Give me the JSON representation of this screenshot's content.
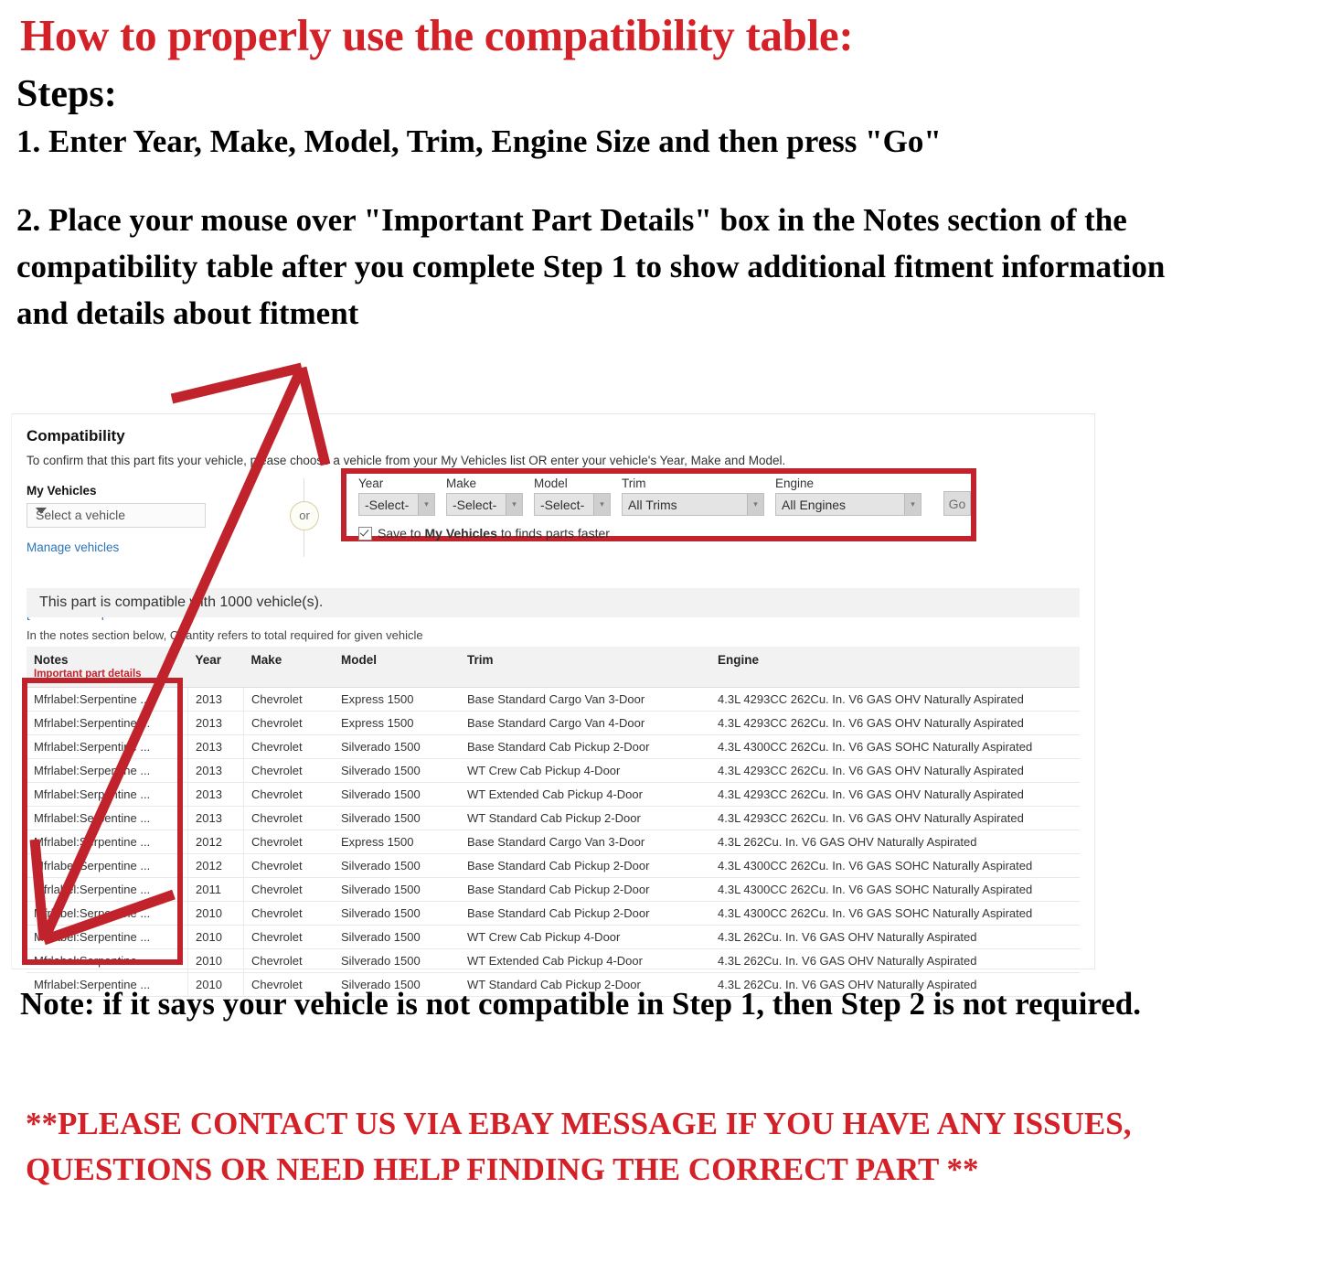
{
  "instructions": {
    "headline": "How to properly use the compatibility table:",
    "steps_label": "Steps:",
    "step1": "1. Enter Year, Make, Model, Trim, Engine Size and then press \"Go\"",
    "step2": "2. Place your mouse over \"Important Part Details\" box in the Notes section of the compatibility table after you complete Step 1 to show additional fitment information and details about fitment"
  },
  "footer": {
    "note": "Note: if it says your vehicle is not compatible in Step 1, then Step 2 is not required.",
    "contact": "**PLEASE CONTACT US VIA EBAY MESSAGE IF YOU HAVE ANY ISSUES, QUESTIONS OR NEED HELP FINDING THE CORRECT PART **"
  },
  "compatibility": {
    "title": "Compatibility",
    "subtitle": "To confirm that this part fits your vehicle, please choose a vehicle from your My Vehicles list OR enter your vehicle's Year, Make and Model.",
    "my_vehicles": {
      "label": "My Vehicles",
      "select_value": "Select a vehicle",
      "manage_link": "Manage vehicles",
      "show_all_link": "[show all compatible vehicles]"
    },
    "or_divider": "or",
    "picker": {
      "fields": [
        {
          "label": "Year",
          "value": "-Select-"
        },
        {
          "label": "Make",
          "value": "-Select-"
        },
        {
          "label": "Model",
          "value": "-Select-"
        },
        {
          "label": "Trim",
          "value": "All Trims"
        },
        {
          "label": "Engine",
          "value": "All Engines"
        }
      ],
      "go_label": "Go",
      "save_prefix": "Save to",
      "save_bold": "My Vehicles",
      "save_suffix": "to finds parts faster",
      "save_checked": true
    },
    "banner": "This part is compatible with 1000 vehicle(s).",
    "notes_hint": "In the notes section below, Quantity refers to total required for given vehicle",
    "table": {
      "columns": [
        "Notes",
        "Year",
        "Make",
        "Model",
        "Trim",
        "Engine"
      ],
      "notes_subheader": "Important part details",
      "rows": [
        {
          "notes": "Mfrlabel:Serpentine ...",
          "year": "2013",
          "make": "Chevrolet",
          "model": "Express 1500",
          "trim": "Base Standard Cargo Van 3-Door",
          "engine": "4.3L 4293CC 262Cu. In. V6 GAS OHV Naturally Aspirated"
        },
        {
          "notes": "Mfrlabel:Serpentine ...",
          "year": "2013",
          "make": "Chevrolet",
          "model": "Express 1500",
          "trim": "Base Standard Cargo Van 4-Door",
          "engine": "4.3L 4293CC 262Cu. In. V6 GAS OHV Naturally Aspirated"
        },
        {
          "notes": "Mfrlabel:Serpentine ...",
          "year": "2013",
          "make": "Chevrolet",
          "model": "Silverado 1500",
          "trim": "Base Standard Cab Pickup 2-Door",
          "engine": "4.3L 4300CC 262Cu. In. V6 GAS SOHC Naturally Aspirated"
        },
        {
          "notes": "Mfrlabel:Serpentine ...",
          "year": "2013",
          "make": "Chevrolet",
          "model": "Silverado 1500",
          "trim": "WT Crew Cab Pickup 4-Door",
          "engine": "4.3L 4293CC 262Cu. In. V6 GAS OHV Naturally Aspirated"
        },
        {
          "notes": "Mfrlabel:Serpentine ...",
          "year": "2013",
          "make": "Chevrolet",
          "model": "Silverado 1500",
          "trim": "WT Extended Cab Pickup 4-Door",
          "engine": "4.3L 4293CC 262Cu. In. V6 GAS OHV Naturally Aspirated"
        },
        {
          "notes": "Mfrlabel:Serpentine ...",
          "year": "2013",
          "make": "Chevrolet",
          "model": "Silverado 1500",
          "trim": "WT Standard Cab Pickup 2-Door",
          "engine": "4.3L 4293CC 262Cu. In. V6 GAS OHV Naturally Aspirated"
        },
        {
          "notes": "Mfrlabel:Serpentine ...",
          "year": "2012",
          "make": "Chevrolet",
          "model": "Express 1500",
          "trim": "Base Standard Cargo Van 3-Door",
          "engine": "4.3L 262Cu. In. V6 GAS OHV Naturally Aspirated"
        },
        {
          "notes": "Mfrlabel:Serpentine ...",
          "year": "2012",
          "make": "Chevrolet",
          "model": "Silverado 1500",
          "trim": "Base Standard Cab Pickup 2-Door",
          "engine": "4.3L 4300CC 262Cu. In. V6 GAS SOHC Naturally Aspirated"
        },
        {
          "notes": "Mfrlabel:Serpentine ...",
          "year": "2011",
          "make": "Chevrolet",
          "model": "Silverado 1500",
          "trim": "Base Standard Cab Pickup 2-Door",
          "engine": "4.3L 4300CC 262Cu. In. V6 GAS SOHC Naturally Aspirated"
        },
        {
          "notes": "Mfrlabel:Serpentine ...",
          "year": "2010",
          "make": "Chevrolet",
          "model": "Silverado 1500",
          "trim": "Base Standard Cab Pickup 2-Door",
          "engine": "4.3L 4300CC 262Cu. In. V6 GAS SOHC Naturally Aspirated"
        },
        {
          "notes": "Mfrlabel:Serpentine ...",
          "year": "2010",
          "make": "Chevrolet",
          "model": "Silverado 1500",
          "trim": "WT Crew Cab Pickup 4-Door",
          "engine": "4.3L 262Cu. In. V6 GAS OHV Naturally Aspirated"
        },
        {
          "notes": "Mfrlabel:Serpentine ...",
          "year": "2010",
          "make": "Chevrolet",
          "model": "Silverado 1500",
          "trim": "WT Extended Cab Pickup 4-Door",
          "engine": "4.3L 262Cu. In. V6 GAS OHV Naturally Aspirated"
        },
        {
          "notes": "Mfrlabel:Serpentine ...",
          "year": "2010",
          "make": "Chevrolet",
          "model": "Silverado 1500",
          "trim": "WT Standard Cab Pickup 2-Door",
          "engine": "4.3L 262Cu. In. V6 GAS OHV Naturally Aspirated"
        }
      ]
    }
  },
  "annotations": {
    "highlight_color": "#c0232b",
    "arrow_color": "#c0232b",
    "arrow_name": "double-headed-arrow"
  }
}
